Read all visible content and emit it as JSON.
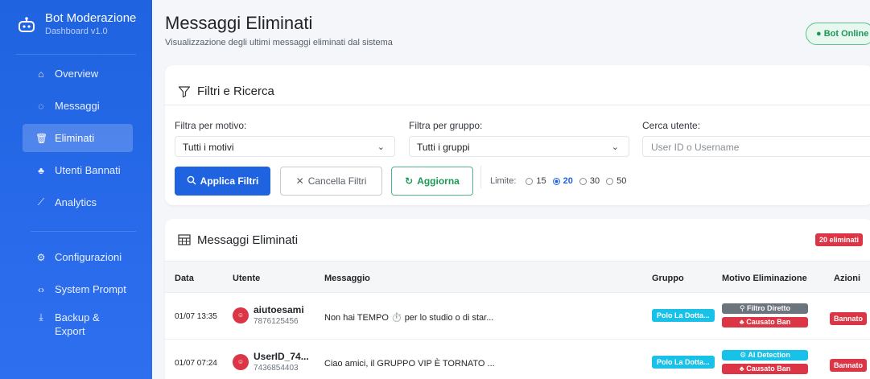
{
  "sidebar": {
    "brand_title": "Bot Moderazione",
    "brand_sub": "Dashboard v1.0",
    "items": [
      {
        "label": "Overview",
        "icon": "home-icon"
      },
      {
        "label": "Messaggi",
        "icon": "chat-icon"
      },
      {
        "label": "Eliminati",
        "icon": "trash-icon",
        "active": true
      },
      {
        "label": "Utenti Bannati",
        "icon": "users-ban-icon"
      },
      {
        "label": "Analytics",
        "icon": "chart-line-icon"
      }
    ],
    "items2": [
      {
        "label": "Configurazioni",
        "icon": "gear-icon"
      },
      {
        "label": "System Prompt",
        "icon": "code-icon"
      },
      {
        "label": "Backup & Export",
        "icon": "download-icon"
      }
    ]
  },
  "header": {
    "title": "Messaggi Eliminati",
    "subtitle": "Visualizzazione degli ultimi messaggi eliminati dal sistema",
    "status": "● Bot Online"
  },
  "filters": {
    "title": "Filtri e Ricerca",
    "motivo_label": "Filtra per motivo:",
    "motivo_value": "Tutti i motivi",
    "gruppo_label": "Filtra per gruppo:",
    "gruppo_value": "Tutti i gruppi",
    "utente_label": "Cerca utente:",
    "utente_placeholder": "User ID o Username",
    "apply_label": "Applica Filtri",
    "clear_label": "Cancella Filtri",
    "refresh_label": "Aggiorna",
    "limit_label": "Limite:",
    "limit_options": [
      "15",
      "20",
      "30",
      "50"
    ],
    "limit_selected": "20"
  },
  "table": {
    "title": "Messaggi Eliminati",
    "count_badge": "20 eliminati",
    "columns": [
      "Data",
      "Utente",
      "Messaggio",
      "Gruppo",
      "Motivo Eliminazione",
      "Azioni"
    ],
    "rows": [
      {
        "date": "01/07 13:35",
        "username": "aiutoesami",
        "user_id": "7876125456",
        "message": "Non hai TEMPO ⏱️ per lo studio o di star...",
        "group": "Polo La Dotta...",
        "motivo_1": "⚲ Filtro Diretto",
        "motivo_2": "♣ Causato Ban",
        "action": "Bannato"
      },
      {
        "date": "01/07 07:24",
        "username": "UserID_74...",
        "user_id": "7436854403",
        "message": "Ciao amici, il GRUPPO VIP È TORNATO ...",
        "group": "Polo La Dotta...",
        "motivo_1": "⚙ AI Detection",
        "motivo_2": "♣ Causato Ban",
        "action": "Bannato"
      }
    ]
  },
  "colors": {
    "sidebar": "#1f63e0",
    "primary": "#1f63e0",
    "success": "#1a9a55",
    "danger": "#dc3545",
    "info": "#17c1e8",
    "secondary": "#6c757d"
  }
}
